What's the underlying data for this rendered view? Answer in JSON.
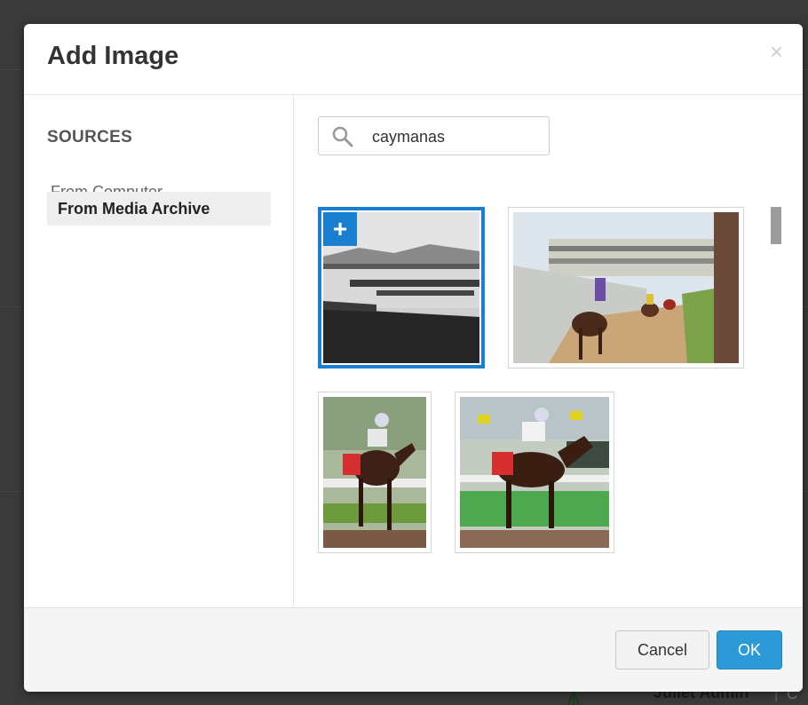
{
  "dialog": {
    "title": "Add Image",
    "close_label": "×"
  },
  "sidebar": {
    "heading": "SOURCES",
    "items": [
      {
        "label": "From Computer",
        "active": false
      },
      {
        "label": "From Media Archive",
        "active": true
      }
    ]
  },
  "search": {
    "value": "caymanas",
    "icon": "search-icon"
  },
  "results": [
    {
      "name": "historic-racecourse-photo",
      "selected": true,
      "add_label": "+"
    },
    {
      "name": "horses-walking-track-photo",
      "selected": false
    },
    {
      "name": "jockey-racing-photo-1",
      "selected": false
    },
    {
      "name": "jockey-racing-photo-2",
      "selected": false
    }
  ],
  "footer": {
    "cancel_label": "Cancel",
    "ok_label": "OK"
  },
  "background": {
    "user_name": "Juliet Admin",
    "separator": "|",
    "extra": "C"
  },
  "colors": {
    "accent": "#1a7fd0",
    "ok_button": "#2c9ad6"
  }
}
